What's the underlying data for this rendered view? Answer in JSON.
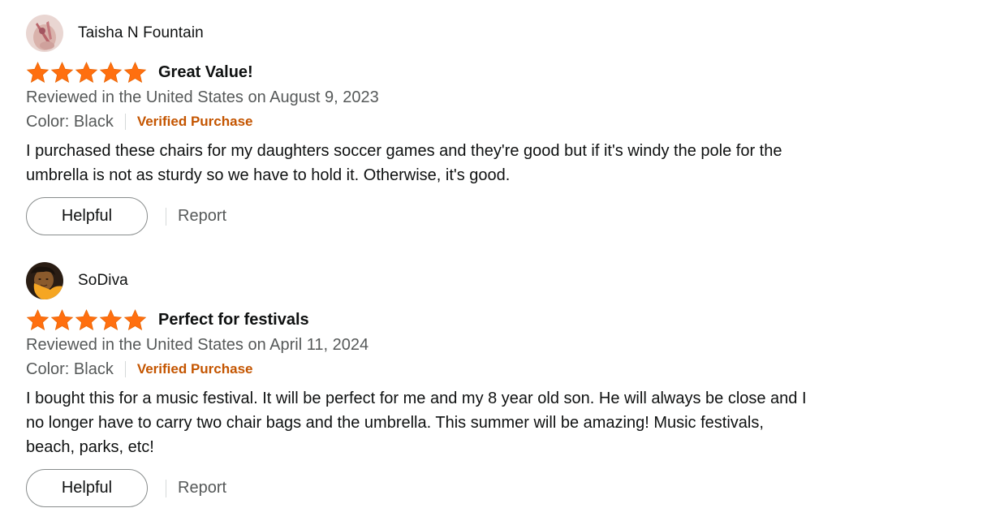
{
  "reviews": [
    {
      "profile_name": "Taisha N Fountain",
      "rating": 5,
      "rating_max": 5,
      "title": "Great Value!",
      "date": "Reviewed in the United States on August 9, 2023",
      "variant": "Color: Black",
      "verified": "Verified Purchase",
      "body_lines": [
        "I purchased these chairs for my daughters soccer games and they're good but if it's windy the pole for the",
        "umbrella is not as sturdy so we have to hold it. Otherwise, it's good."
      ],
      "helpful_label": "Helpful",
      "report_label": "Report"
    },
    {
      "profile_name": "SoDiva",
      "rating": 5,
      "rating_max": 5,
      "title": "Perfect for festivals",
      "date": "Reviewed in the United States on April 11, 2024",
      "variant": "Color: Black",
      "verified": "Verified Purchase",
      "body_lines": [
        "I bought this for a music festival. It will be perfect for me and my 8 year old son. He will always be close and I",
        "no longer have to carry two chair bags and the umbrella. This summer will be amazing! Music festivals,",
        "beach, parks, etc!"
      ],
      "helpful_label": "Helpful",
      "report_label": "Report"
    }
  ],
  "colors": {
    "star": "#ff6f0f",
    "verified": "#c45500",
    "secondary_text": "#565959",
    "primary_text": "#0f1111"
  },
  "icons": {
    "star": "star-icon"
  }
}
